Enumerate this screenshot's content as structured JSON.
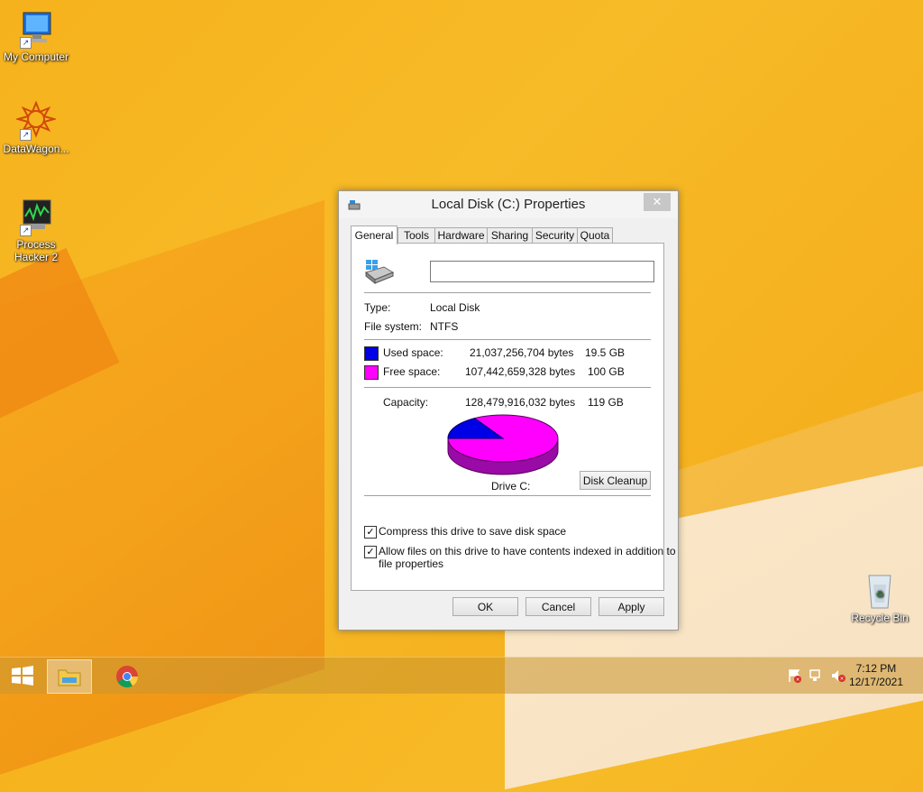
{
  "desktop": {
    "icons": [
      {
        "label": "My Computer",
        "icon": "computer-icon"
      },
      {
        "label": "DataWagon...",
        "icon": "datawagon-icon"
      },
      {
        "label": "Process Hacker 2",
        "icon": "process-hacker-icon"
      },
      {
        "label": "Recycle Bin",
        "icon": "recycle-bin-icon"
      }
    ]
  },
  "dialog": {
    "title": "Local Disk (C:) Properties",
    "close_glyph": "✕",
    "tabs": [
      "General",
      "Tools",
      "Hardware",
      "Sharing",
      "Security",
      "Quota"
    ],
    "active_tab": "General",
    "drive_name_value": "",
    "type_label": "Type:",
    "type_value": "Local Disk",
    "fs_label": "File system:",
    "fs_value": "NTFS",
    "used_label": "Used space:",
    "used_bytes": "21,037,256,704 bytes",
    "used_gb": "19.5 GB",
    "used_color": "#0000e6",
    "free_label": "Free space:",
    "free_bytes": "107,442,659,328 bytes",
    "free_gb": "100 GB",
    "free_color": "#ff00ff",
    "capacity_label": "Capacity:",
    "capacity_bytes": "128,479,916,032 bytes",
    "capacity_gb": "119 GB",
    "used_fraction": 0.164,
    "drive_label": "Drive C:",
    "disk_cleanup_label": "Disk Cleanup",
    "compress_label": "Compress this drive to save disk space",
    "compress_checked": true,
    "index_label_line1": "Allow files on this drive to have contents indexed in addition to",
    "index_label_line2": "file properties",
    "index_checked": true,
    "ok_label": "OK",
    "cancel_label": "Cancel",
    "apply_label": "Apply"
  },
  "taskbar": {
    "items": [
      "start-icon",
      "file-explorer-icon",
      "chrome-icon"
    ],
    "tray": [
      "action-center-flag-icon",
      "network-icon",
      "volume-muted-icon"
    ],
    "time": "7:12 PM",
    "date": "12/17/2021"
  }
}
